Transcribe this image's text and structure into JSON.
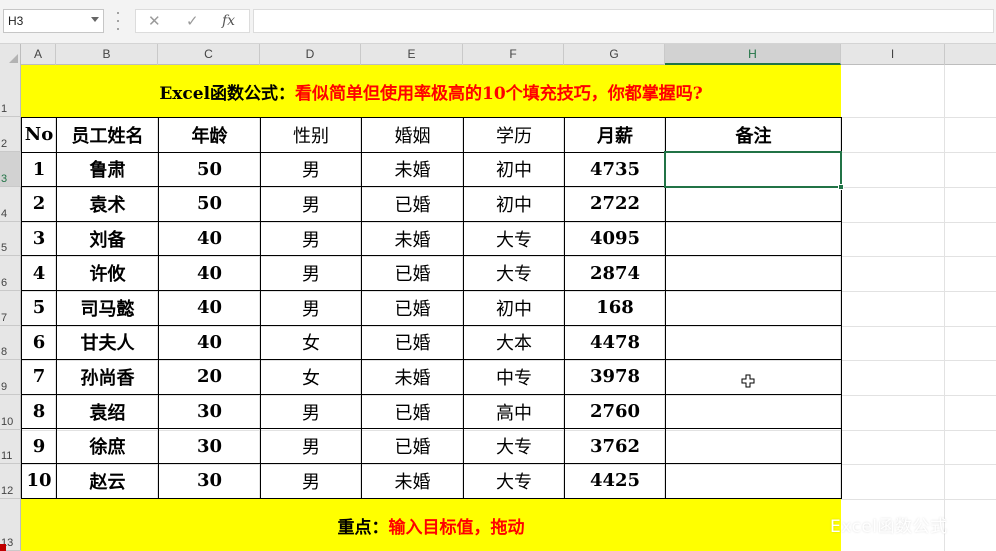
{
  "formula_bar": {
    "name_box": "H3",
    "cancel_icon": "✕",
    "enter_icon": "✓",
    "fx_label": "fx",
    "formula": ""
  },
  "columns": [
    "A",
    "B",
    "C",
    "D",
    "E",
    "F",
    "G",
    "H",
    "I"
  ],
  "rows": [
    "1",
    "2",
    "3",
    "4",
    "5",
    "6",
    "7",
    "8",
    "9",
    "10",
    "11",
    "12",
    "13"
  ],
  "active_cell": "H3",
  "title_banner": {
    "prefix": "Excel函数公式：",
    "text": "看似简单但使用率极高的10个填充技巧，你都掌握吗?"
  },
  "table": {
    "headers": [
      "No",
      "员工姓名",
      "年龄",
      "性别",
      "婚姻",
      "学历",
      "月薪",
      "备注"
    ],
    "rows": [
      [
        "1",
        "鲁肃",
        "50",
        "男",
        "未婚",
        "初中",
        "4735",
        ""
      ],
      [
        "2",
        "袁术",
        "50",
        "男",
        "已婚",
        "初中",
        "2722",
        ""
      ],
      [
        "3",
        "刘备",
        "40",
        "男",
        "未婚",
        "大专",
        "4095",
        ""
      ],
      [
        "4",
        "许攸",
        "40",
        "男",
        "已婚",
        "大专",
        "2874",
        ""
      ],
      [
        "5",
        "司马懿",
        "40",
        "男",
        "已婚",
        "初中",
        "168",
        ""
      ],
      [
        "6",
        "甘夫人",
        "40",
        "女",
        "已婚",
        "大本",
        "4478",
        ""
      ],
      [
        "7",
        "孙尚香",
        "20",
        "女",
        "未婚",
        "中专",
        "3978",
        ""
      ],
      [
        "8",
        "袁绍",
        "30",
        "男",
        "已婚",
        "高中",
        "2760",
        ""
      ],
      [
        "9",
        "徐庶",
        "30",
        "男",
        "已婚",
        "大专",
        "3762",
        ""
      ],
      [
        "10",
        "赵云",
        "30",
        "男",
        "未婚",
        "大专",
        "4425",
        ""
      ]
    ]
  },
  "footer_banner": {
    "prefix": "重点：",
    "text": "输入目标值，拖动"
  },
  "watermark": "Excel函数公式",
  "colors": {
    "banner_bg": "#ffff00",
    "accent_red": "#ff0000",
    "selection_green": "#217346"
  }
}
